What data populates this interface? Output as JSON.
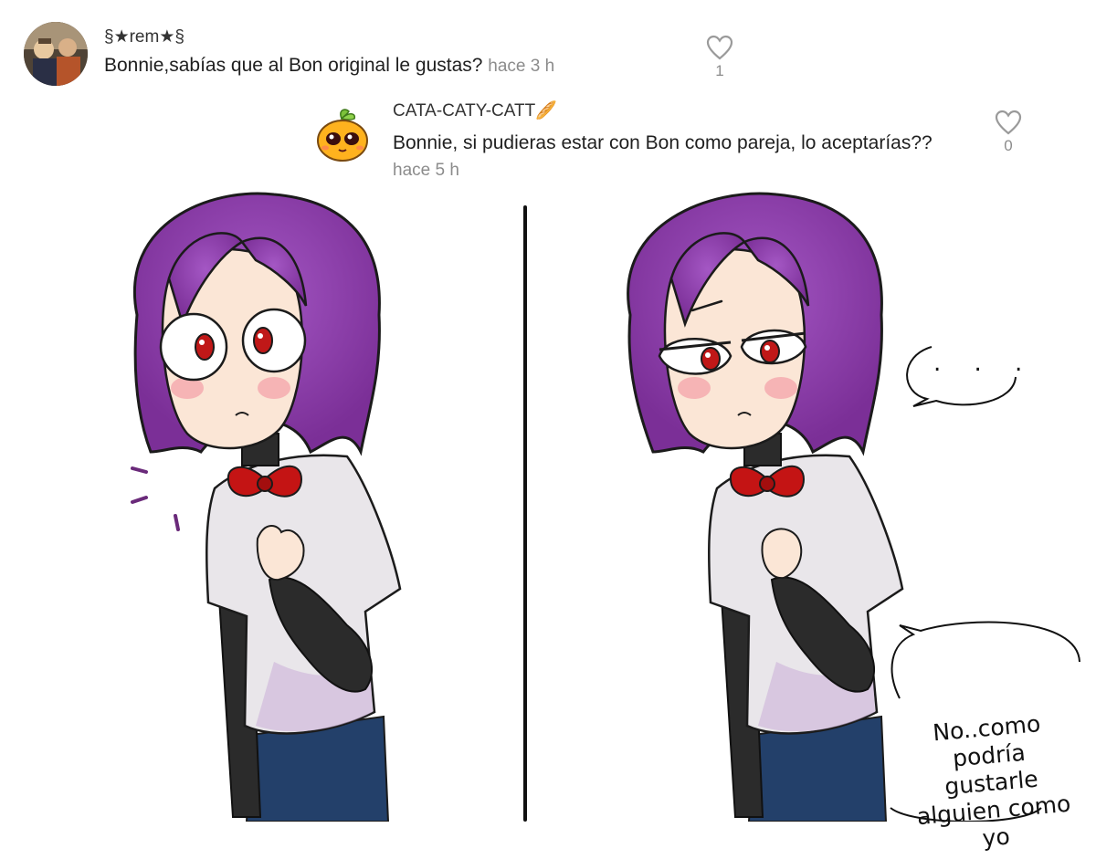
{
  "comments": [
    {
      "username": "§★rem★§",
      "text": "Bonnie,sabías que al Bon original le gustas?",
      "time": "hace 3 h",
      "likes": "1",
      "avatar_icon": "profile-photo"
    },
    {
      "username": "CATA-CATY-CATT🥖",
      "text": "Bonnie, si pudieras estar con Bon como pareja, lo aceptarías??",
      "time": "hace 5 h",
      "likes": "0",
      "avatar_icon": "orange-fruit-character"
    }
  ],
  "comic": {
    "bubble_dots": ". . .",
    "bubble_lines": [
      "No..como podría",
      "gustarle",
      "alguien como yo"
    ]
  },
  "colors": {
    "hair": "#8a3fa6",
    "skin": "#fbe6d6",
    "shirt": "#e9e6ea",
    "sleeves": "#2b2b2b",
    "bow": "#c41414",
    "eyes": "#c01818",
    "pants": "#23406a",
    "like_icon": "#9a9a9a"
  }
}
